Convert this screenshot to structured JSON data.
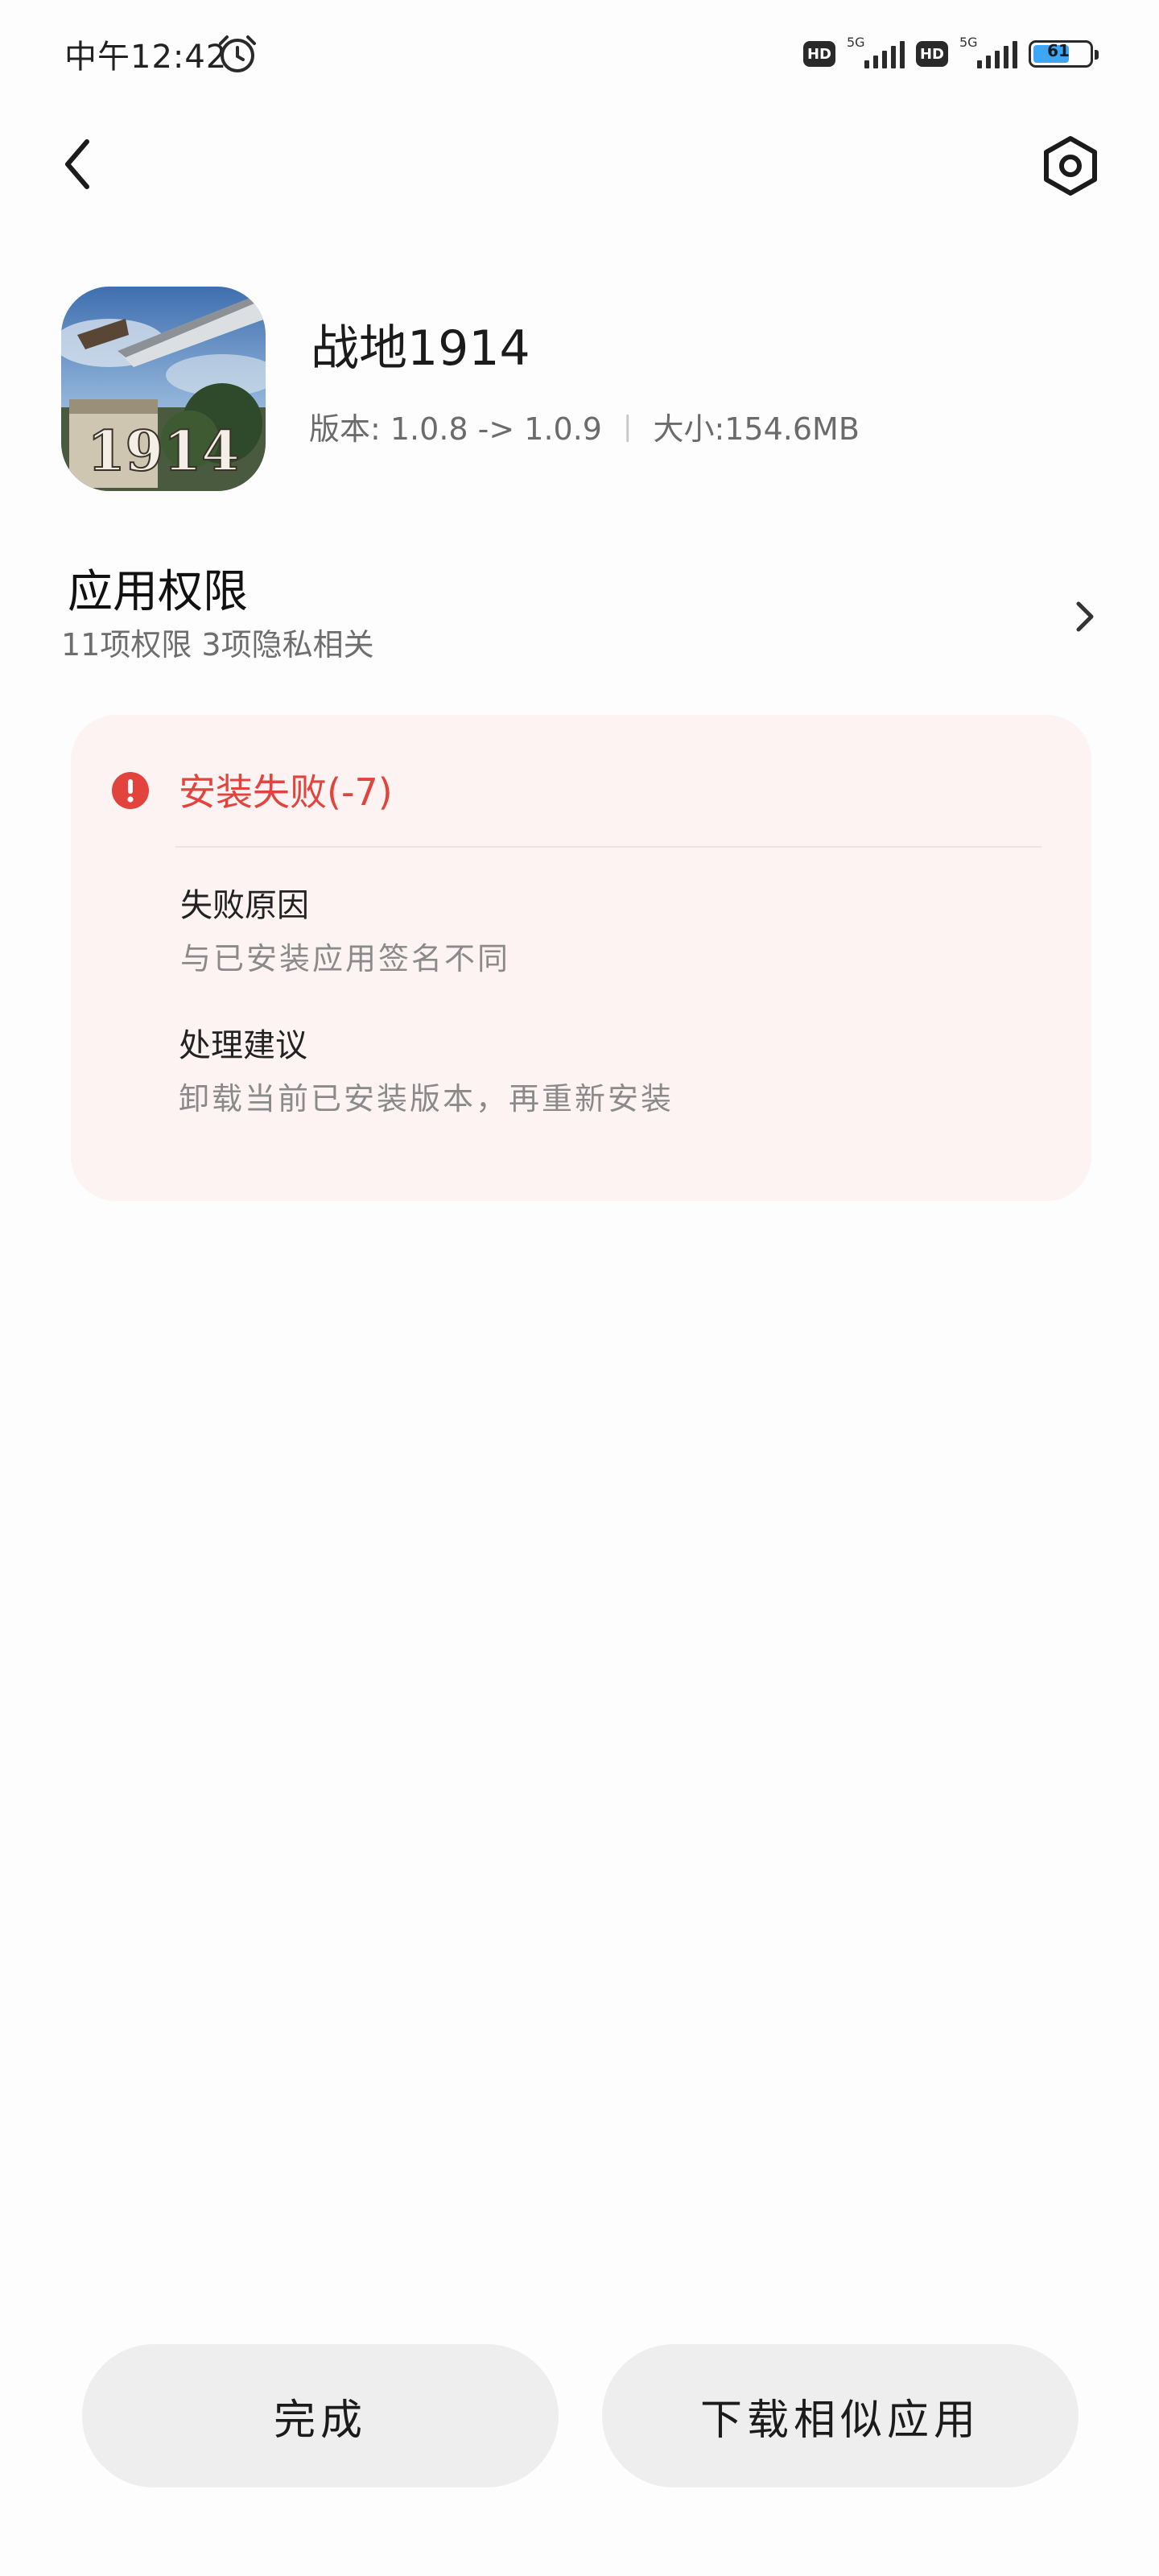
{
  "status_bar": {
    "time": "中午12:42",
    "hd_label": "HD",
    "network_label": "5G",
    "battery_level": "61",
    "battery_color": "#3ea6f5"
  },
  "nav": {
    "back_icon": "chevron-left-icon",
    "settings_icon": "settings-hexagon-icon"
  },
  "app": {
    "name": "战地1914",
    "version_text": "版本: 1.0.8 -> 1.0.9",
    "separator": "|",
    "size_text": "大小:154.6MB",
    "icon_label": "1914"
  },
  "permissions": {
    "title": "应用权限",
    "subtitle": "11项权限 3项隐私相关"
  },
  "error": {
    "title": "安装失败(-7)",
    "reason_label": "失败原因",
    "reason_value": "与已安装应用签名不同",
    "advice_label": "处理建议",
    "advice_value": "卸载当前已安装版本，再重新安装",
    "accent_color": "#e2443d",
    "card_color": "#fdf3f3"
  },
  "actions": {
    "done_label": "完成",
    "similar_label": "下载相似应用"
  }
}
